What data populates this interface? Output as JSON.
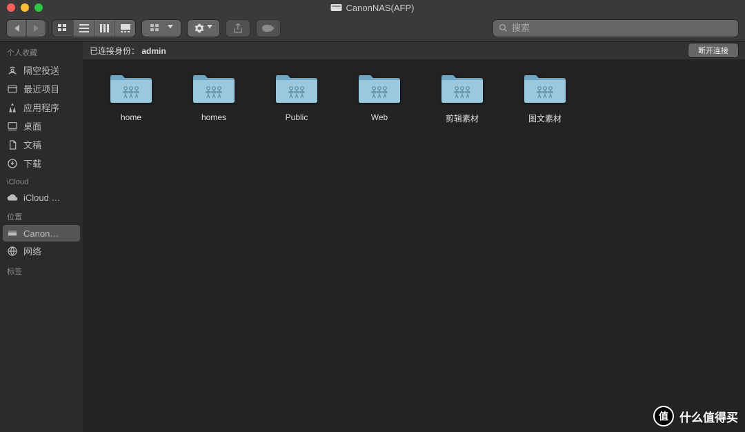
{
  "title": "CanonNAS(AFP)",
  "search_placeholder": "搜索",
  "status": {
    "connected_as_label": "已连接身份：",
    "user": "admin",
    "disconnect": "断开连接"
  },
  "sidebar": {
    "sections": [
      {
        "header": "个人收藏",
        "items": [
          {
            "label": "隔空投送",
            "icon": "airdrop"
          },
          {
            "label": "最近项目",
            "icon": "recents"
          },
          {
            "label": "应用程序",
            "icon": "apps"
          },
          {
            "label": "桌面",
            "icon": "desktop"
          },
          {
            "label": "文稿",
            "icon": "docs"
          },
          {
            "label": "下载",
            "icon": "downloads"
          }
        ]
      },
      {
        "header": "iCloud",
        "items": [
          {
            "label": "iCloud …",
            "icon": "cloud"
          }
        ]
      },
      {
        "header": "位置",
        "items": [
          {
            "label": "Canon…",
            "icon": "server",
            "selected": true
          },
          {
            "label": "网络",
            "icon": "network"
          }
        ]
      },
      {
        "header": "标签",
        "items": []
      }
    ]
  },
  "folders": [
    {
      "name": "home"
    },
    {
      "name": "homes"
    },
    {
      "name": "Public"
    },
    {
      "name": "Web"
    },
    {
      "name": "剪辑素材"
    },
    {
      "name": "图文素材"
    }
  ],
  "watermark": "什么值得买",
  "watermark_badge": "值"
}
